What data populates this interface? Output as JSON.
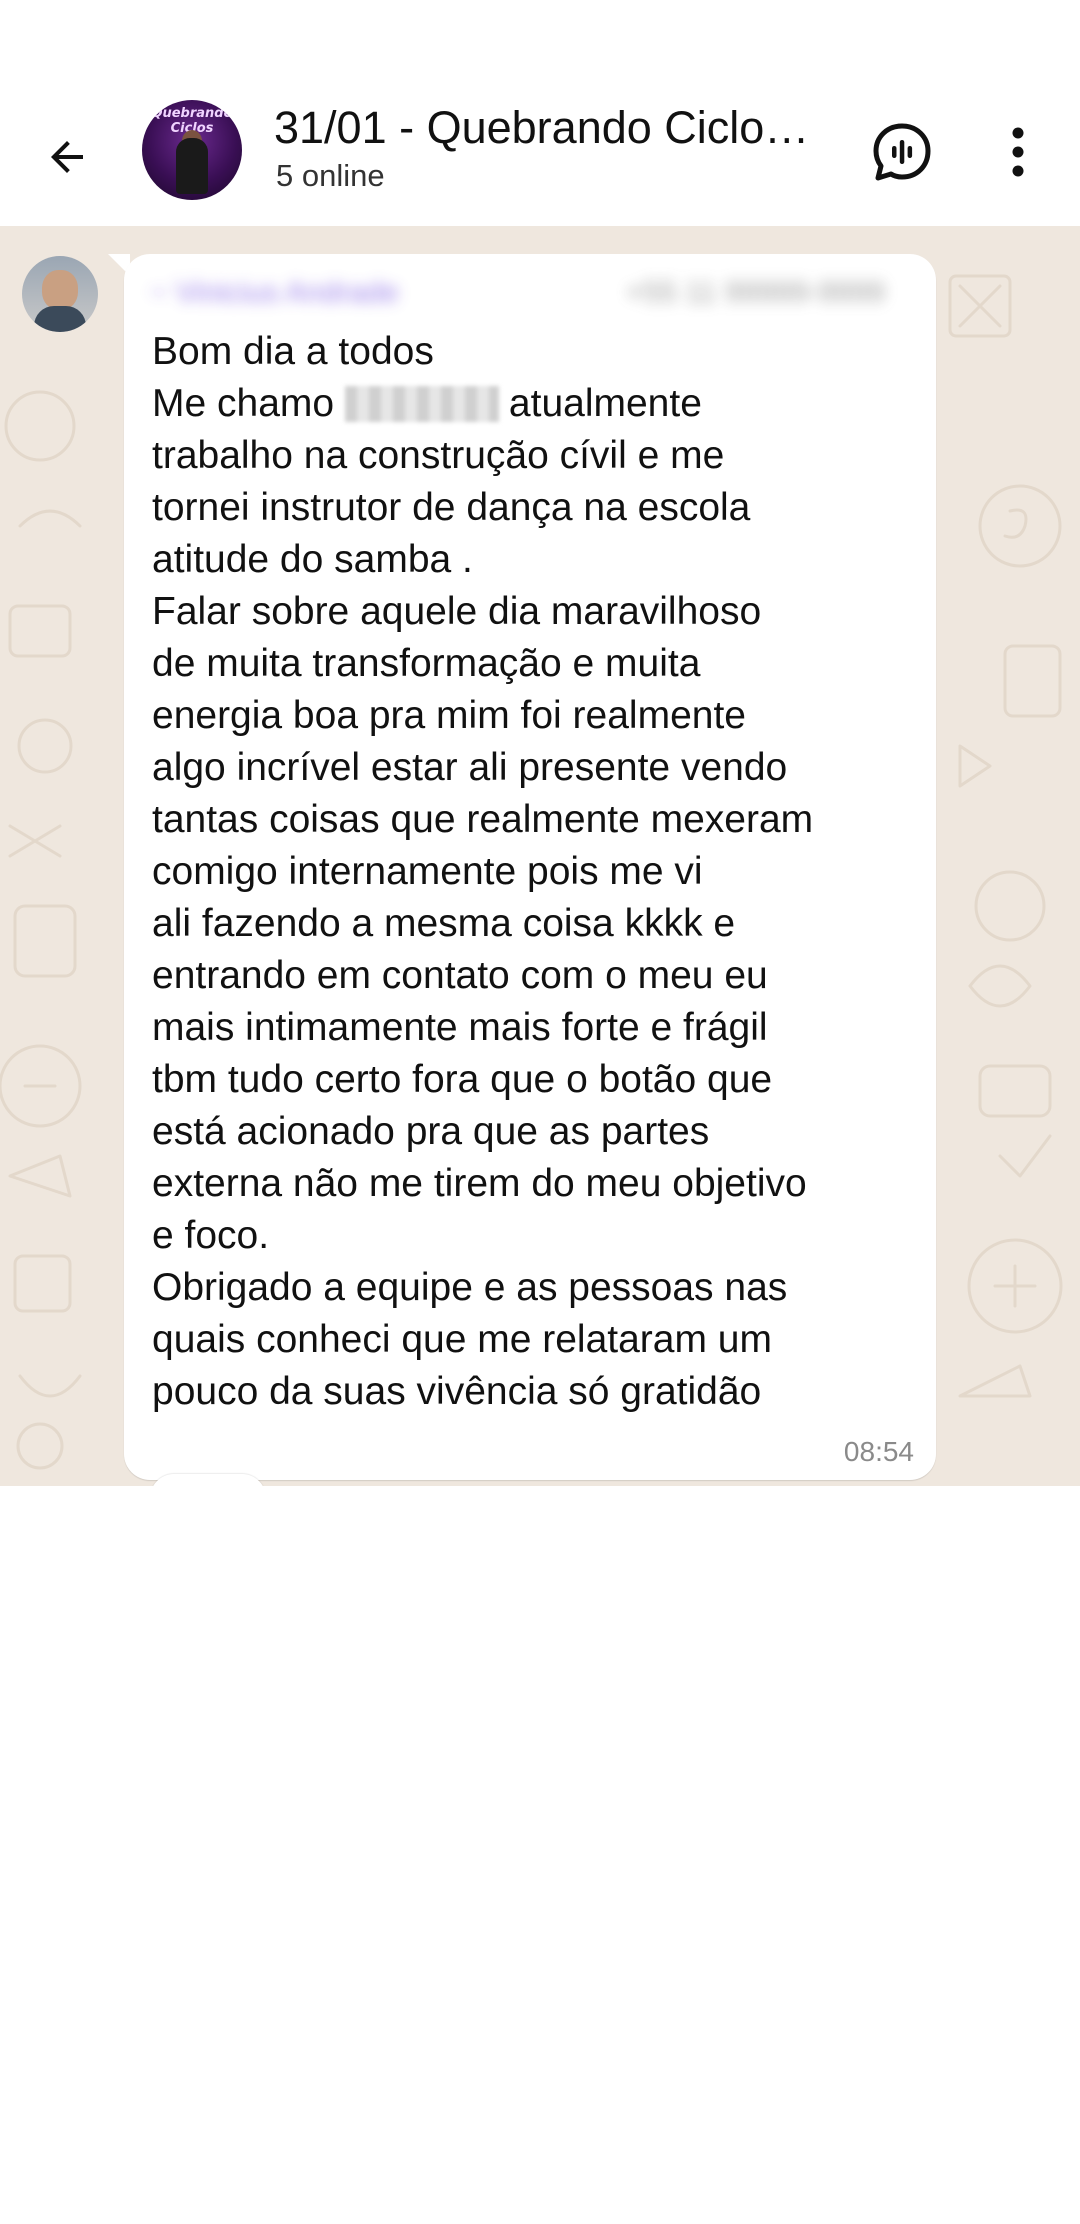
{
  "header": {
    "title": "31/01 - Quebrando Ciclo…",
    "subtitle": "5 online",
    "avatar_text_line1": "Quebrando",
    "avatar_text_line2": "Ciclos",
    "icons": {
      "back": "arrow-left-icon",
      "voice_chat": "voice-chat-icon",
      "menu": "more-vert-icon"
    }
  },
  "message": {
    "sender_name": "~ Vinicius Andrade",
    "sender_phone": "+55 11 99999-9999",
    "lines": [
      "Bom dia a todos",
      "atualmente",
      "trabalho na construção cívil e me",
      "tornei instrutor de dança na escola",
      "atitude do samba .",
      "Falar sobre aquele dia maravilhoso",
      "de muita transformação e muita",
      "energia boa pra mim foi realmente",
      "algo incrível estar ali presente vendo",
      "tantas coisas que realmente mexeram",
      "comigo internamente pois me vi",
      "ali fazendo a mesma coisa kkkk e",
      "entrando em contato com o meu eu",
      "mais intimamente mais forte e frágil",
      "tbm tudo certo fora que o botão que",
      "está acionado pra que as partes",
      "externa não me tirem do meu objetivo",
      "e foco.",
      "Obrigado a equipe e as pessoas nas",
      "quais conheci que me relataram um",
      "pouco da suas vivência só gratidão"
    ],
    "line2_prefix": "Me chamo",
    "time": "08:54"
  },
  "colors": {
    "wallpaper": "#efe7de",
    "bubble": "#ffffff",
    "sender_name": "#8a6ce6",
    "time": "#8a8a8a",
    "text": "#111111"
  }
}
